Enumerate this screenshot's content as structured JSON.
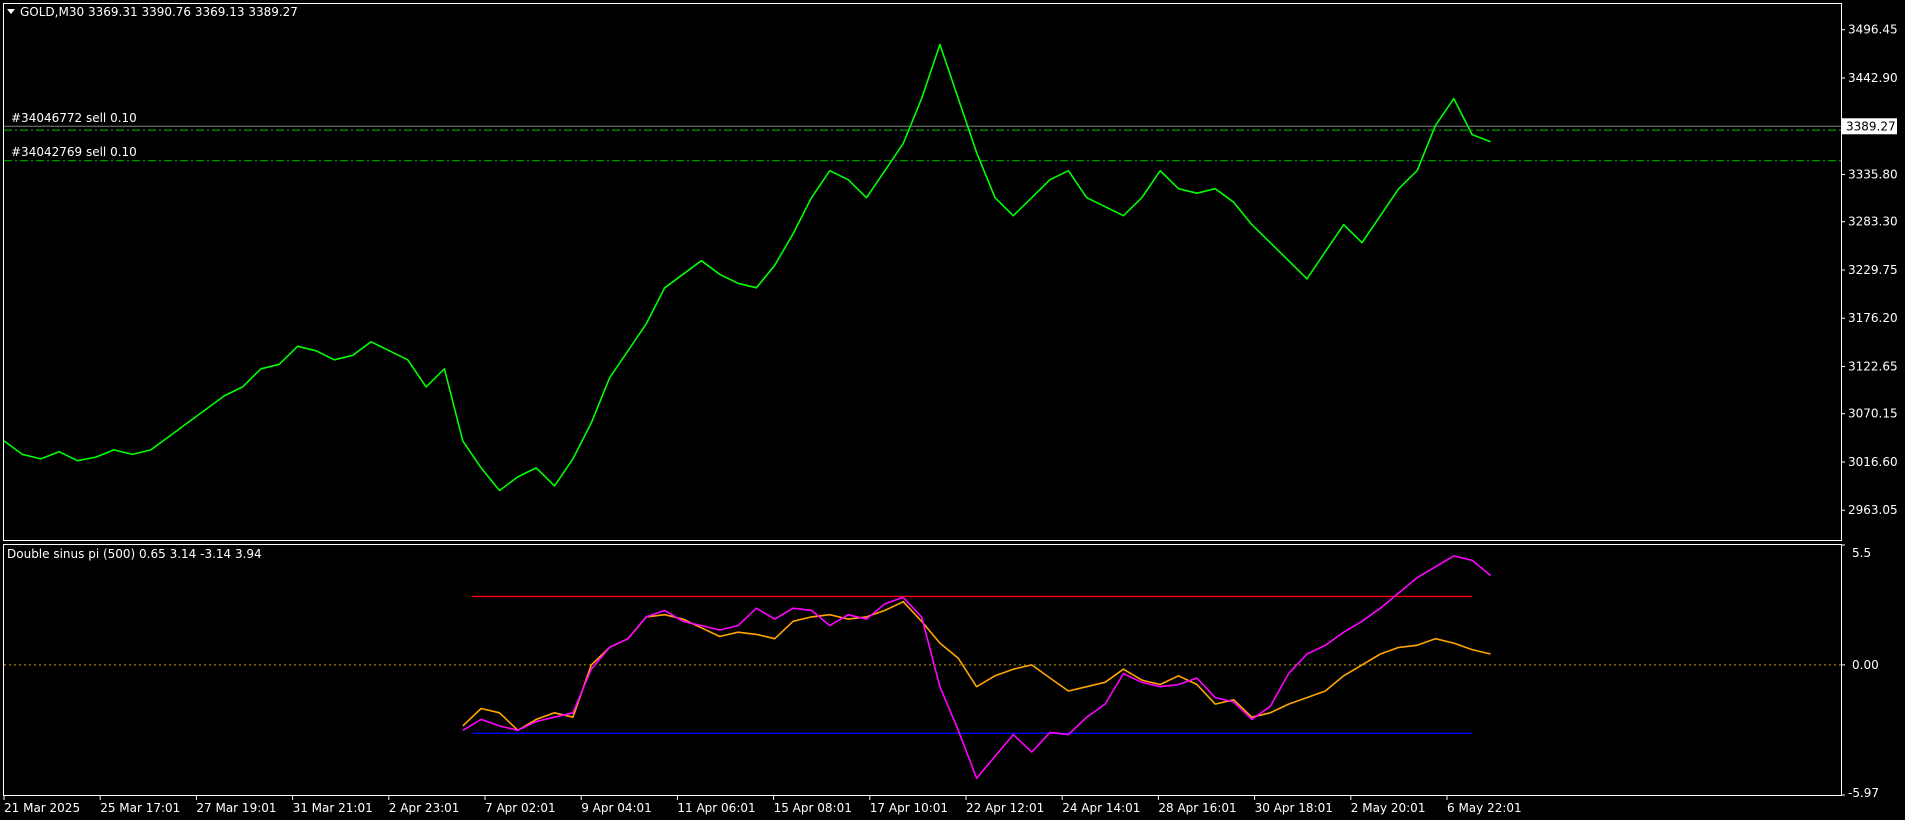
{
  "symbol_header": {
    "symbol": "GOLD,M30",
    "ohlc": "3369.31 3390.76 3369.13 3389.27"
  },
  "orders": [
    {
      "label": "#34046772 sell 0.10",
      "price": 3385.0
    },
    {
      "label": "#34042769 sell 0.10",
      "price": 3351.0
    }
  ],
  "current_price_label": "3389.27",
  "colors": {
    "background": "#000000",
    "frame": "#ffffff",
    "price_line": "#00ff00",
    "order_line": "#00c000",
    "series_magenta": "#ff00ff",
    "series_orange": "#ffa500",
    "upper_level": "#ff0000",
    "lower_level": "#0000ff",
    "zero_level": "#c8a000"
  },
  "indicator_header": {
    "text": "Double sinus pi (500) 0.65 3.14 -3.14 3.94"
  },
  "time_axis_labels": [
    "21 Mar 2025",
    "25 Mar 17:01",
    "27 Mar 19:01",
    "31 Mar 21:01",
    "2 Apr 23:01",
    "7 Apr 02:01",
    "9 Apr 04:01",
    "11 Apr 06:01",
    "15 Apr 08:01",
    "17 Apr 10:01",
    "22 Apr 12:01",
    "24 Apr 14:01",
    "28 Apr 16:01",
    "30 Apr 18:01",
    "2 May 20:01",
    "6 May 22:01"
  ],
  "chart_data": [
    {
      "type": "line",
      "title": "GOLD,M30",
      "ylim": [
        2930,
        3525
      ],
      "y_ticks": [
        "3496.45",
        "3442.90",
        "3389.35",
        "3335.80",
        "3283.30",
        "3229.75",
        "3176.20",
        "3122.65",
        "3070.15",
        "3016.60",
        "2963.05"
      ],
      "x_range": [
        0,
        100
      ],
      "series": [
        {
          "color": "#00ff00",
          "points": [
            [
              0,
              3040
            ],
            [
              1,
              3025
            ],
            [
              2,
              3020
            ],
            [
              3,
              3028
            ],
            [
              4,
              3018
            ],
            [
              5,
              3022
            ],
            [
              6,
              3030
            ],
            [
              7,
              3025
            ],
            [
              8,
              3030
            ],
            [
              9,
              3045
            ],
            [
              10,
              3060
            ],
            [
              11,
              3075
            ],
            [
              12,
              3090
            ],
            [
              13,
              3100
            ],
            [
              14,
              3120
            ],
            [
              15,
              3125
            ],
            [
              16,
              3145
            ],
            [
              17,
              3140
            ],
            [
              18,
              3130
            ],
            [
              19,
              3135
            ],
            [
              20,
              3150
            ],
            [
              21,
              3140
            ],
            [
              22,
              3130
            ],
            [
              23,
              3100
            ],
            [
              24,
              3120
            ],
            [
              25,
              3040
            ],
            [
              26,
              3010
            ],
            [
              27,
              2985
            ],
            [
              28,
              3000
            ],
            [
              29,
              3010
            ],
            [
              30,
              2990
            ],
            [
              31,
              3020
            ],
            [
              32,
              3060
            ],
            [
              33,
              3110
            ],
            [
              34,
              3140
            ],
            [
              35,
              3170
            ],
            [
              36,
              3210
            ],
            [
              37,
              3225
            ],
            [
              38,
              3240
            ],
            [
              39,
              3225
            ],
            [
              40,
              3215
            ],
            [
              41,
              3210
            ],
            [
              42,
              3235
            ],
            [
              43,
              3270
            ],
            [
              44,
              3310
            ],
            [
              45,
              3340
            ],
            [
              46,
              3330
            ],
            [
              47,
              3310
            ],
            [
              48,
              3340
            ],
            [
              49,
              3370
            ],
            [
              50,
              3420
            ],
            [
              51,
              3480
            ],
            [
              52,
              3420
            ],
            [
              53,
              3360
            ],
            [
              54,
              3310
            ],
            [
              55,
              3290
            ],
            [
              56,
              3310
            ],
            [
              57,
              3330
            ],
            [
              58,
              3340
            ],
            [
              59,
              3310
            ],
            [
              60,
              3300
            ],
            [
              61,
              3290
            ],
            [
              62,
              3310
            ],
            [
              63,
              3340
            ],
            [
              64,
              3320
            ],
            [
              65,
              3315
            ],
            [
              66,
              3320
            ],
            [
              67,
              3305
            ],
            [
              68,
              3280
            ],
            [
              69,
              3260
            ],
            [
              70,
              3240
            ],
            [
              71,
              3220
            ],
            [
              72,
              3250
            ],
            [
              73,
              3280
            ],
            [
              74,
              3260
            ],
            [
              75,
              3290
            ],
            [
              76,
              3320
            ],
            [
              77,
              3340
            ],
            [
              78,
              3390
            ],
            [
              79,
              3420
            ],
            [
              80,
              3380
            ],
            [
              81,
              3372
            ]
          ]
        }
      ]
    },
    {
      "type": "line",
      "title": "Double sinus pi (500) 0.65 3.14 -3.14 3.94",
      "ylim": [
        -5.97,
        5.5
      ],
      "y_ticks": [
        "5.5",
        "0.00",
        "-5.97"
      ],
      "levels": {
        "upper": 3.14,
        "lower": -3.14,
        "zero": 0
      },
      "series": [
        {
          "color": "#ffa500",
          "points": [
            [
              25,
              -2.8
            ],
            [
              26,
              -2.0
            ],
            [
              27,
              -2.2
            ],
            [
              28,
              -3.0
            ],
            [
              29,
              -2.5
            ],
            [
              30,
              -2.2
            ],
            [
              31,
              -2.4
            ],
            [
              32,
              0.0
            ],
            [
              33,
              0.8
            ],
            [
              34,
              1.2
            ],
            [
              35,
              2.2
            ],
            [
              36,
              2.3
            ],
            [
              37,
              2.1
            ],
            [
              38,
              1.7
            ],
            [
              39,
              1.3
            ],
            [
              40,
              1.5
            ],
            [
              41,
              1.4
            ],
            [
              42,
              1.2
            ],
            [
              43,
              2.0
            ],
            [
              44,
              2.2
            ],
            [
              45,
              2.3
            ],
            [
              46,
              2.1
            ],
            [
              47,
              2.2
            ],
            [
              48,
              2.5
            ],
            [
              49,
              2.9
            ],
            [
              50,
              2.0
            ],
            [
              51,
              1.0
            ],
            [
              52,
              0.3
            ],
            [
              53,
              -1.0
            ],
            [
              54,
              -0.5
            ],
            [
              55,
              -0.2
            ],
            [
              56,
              0.0
            ],
            [
              57,
              -0.6
            ],
            [
              58,
              -1.2
            ],
            [
              59,
              -1.0
            ],
            [
              60,
              -0.8
            ],
            [
              61,
              -0.2
            ],
            [
              62,
              -0.7
            ],
            [
              63,
              -0.9
            ],
            [
              64,
              -0.5
            ],
            [
              65,
              -0.9
            ],
            [
              66,
              -1.8
            ],
            [
              67,
              -1.6
            ],
            [
              68,
              -2.4
            ],
            [
              69,
              -2.2
            ],
            [
              70,
              -1.8
            ],
            [
              71,
              -1.5
            ],
            [
              72,
              -1.2
            ],
            [
              73,
              -0.5
            ],
            [
              74,
              0.0
            ],
            [
              75,
              0.5
            ],
            [
              76,
              0.8
            ],
            [
              77,
              0.9
            ],
            [
              78,
              1.2
            ],
            [
              79,
              1.0
            ],
            [
              80,
              0.7
            ],
            [
              81,
              0.5
            ]
          ]
        },
        {
          "color": "#ff00ff",
          "points": [
            [
              25,
              -3.0
            ],
            [
              26,
              -2.5
            ],
            [
              27,
              -2.8
            ],
            [
              28,
              -3.0
            ],
            [
              29,
              -2.6
            ],
            [
              30,
              -2.4
            ],
            [
              31,
              -2.2
            ],
            [
              32,
              -0.2
            ],
            [
              33,
              0.8
            ],
            [
              34,
              1.2
            ],
            [
              35,
              2.2
            ],
            [
              36,
              2.5
            ],
            [
              37,
              2.0
            ],
            [
              38,
              1.8
            ],
            [
              39,
              1.6
            ],
            [
              40,
              1.8
            ],
            [
              41,
              2.6
            ],
            [
              42,
              2.1
            ],
            [
              43,
              2.6
            ],
            [
              44,
              2.5
            ],
            [
              45,
              1.8
            ],
            [
              46,
              2.3
            ],
            [
              47,
              2.1
            ],
            [
              48,
              2.8
            ],
            [
              49,
              3.1
            ],
            [
              50,
              2.2
            ],
            [
              51,
              -1.0
            ],
            [
              52,
              -3.0
            ],
            [
              53,
              -5.2
            ],
            [
              54,
              -4.2
            ],
            [
              55,
              -3.2
            ],
            [
              56,
              -4.0
            ],
            [
              57,
              -3.1
            ],
            [
              58,
              -3.2
            ],
            [
              59,
              -2.4
            ],
            [
              60,
              -1.8
            ],
            [
              61,
              -0.4
            ],
            [
              62,
              -0.8
            ],
            [
              63,
              -1.0
            ],
            [
              64,
              -0.9
            ],
            [
              65,
              -0.6
            ],
            [
              66,
              -1.5
            ],
            [
              67,
              -1.7
            ],
            [
              68,
              -2.5
            ],
            [
              69,
              -1.9
            ],
            [
              70,
              -0.4
            ],
            [
              71,
              0.5
            ],
            [
              72,
              0.9
            ],
            [
              73,
              1.5
            ],
            [
              74,
              2.0
            ],
            [
              75,
              2.6
            ],
            [
              76,
              3.3
            ],
            [
              77,
              4.0
            ],
            [
              78,
              4.5
            ],
            [
              79,
              5.0
            ],
            [
              80,
              4.8
            ],
            [
              81,
              4.1
            ]
          ]
        }
      ]
    }
  ]
}
